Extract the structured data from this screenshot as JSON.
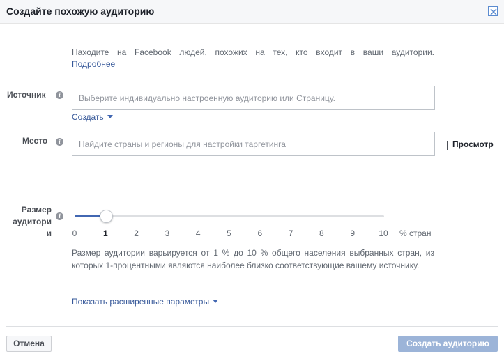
{
  "dialog": {
    "title": "Создайте похожую аудиторию",
    "close_icon": "close-icon"
  },
  "intro": {
    "text": "Находите на Facebook людей, похожих на тех, кто входит в ваши аудитории.",
    "link": "Подробнее"
  },
  "source": {
    "label": "Источник",
    "placeholder": "Выберите индивидуально настроенную аудиторию или Страницу.",
    "create_label": "Создать"
  },
  "location": {
    "label": "Место",
    "placeholder": "Найдите страны и регионы для настройки таргетинга",
    "preview_label": "Просмотр"
  },
  "audience_size": {
    "label_line1": "Размер",
    "label_line2": "аудитори",
    "label_line3": "и",
    "selected": 1,
    "ticks": [
      "0",
      "1",
      "2",
      "3",
      "4",
      "5",
      "6",
      "7",
      "8",
      "9",
      "10"
    ],
    "unit": "% стран",
    "description": "Размер аудитории варьируется от 1 % до 10 % общего населения выбранных стран, из которых 1-процентными являются наиболее близко соответствующие вашему источнику."
  },
  "advanced": {
    "label": "Показать расширенные параметры"
  },
  "footer": {
    "cancel_label": "Отмена",
    "submit_label": "Создать аудиторию"
  },
  "colors": {
    "accent": "#4267b2",
    "link": "#365899",
    "disabled_button": "#9cb4d8"
  }
}
